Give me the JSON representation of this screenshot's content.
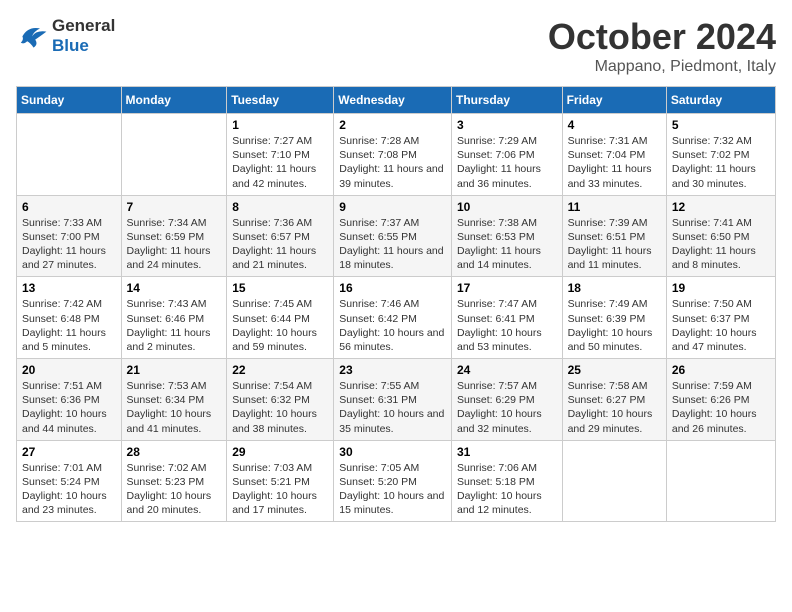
{
  "header": {
    "logo_line1": "General",
    "logo_line2": "Blue",
    "month_title": "October 2024",
    "location": "Mappano, Piedmont, Italy"
  },
  "days_of_week": [
    "Sunday",
    "Monday",
    "Tuesday",
    "Wednesday",
    "Thursday",
    "Friday",
    "Saturday"
  ],
  "weeks": [
    [
      {
        "num": "",
        "sunrise": "",
        "sunset": "",
        "daylight": ""
      },
      {
        "num": "",
        "sunrise": "",
        "sunset": "",
        "daylight": ""
      },
      {
        "num": "1",
        "sunrise": "Sunrise: 7:27 AM",
        "sunset": "Sunset: 7:10 PM",
        "daylight": "Daylight: 11 hours and 42 minutes."
      },
      {
        "num": "2",
        "sunrise": "Sunrise: 7:28 AM",
        "sunset": "Sunset: 7:08 PM",
        "daylight": "Daylight: 11 hours and 39 minutes."
      },
      {
        "num": "3",
        "sunrise": "Sunrise: 7:29 AM",
        "sunset": "Sunset: 7:06 PM",
        "daylight": "Daylight: 11 hours and 36 minutes."
      },
      {
        "num": "4",
        "sunrise": "Sunrise: 7:31 AM",
        "sunset": "Sunset: 7:04 PM",
        "daylight": "Daylight: 11 hours and 33 minutes."
      },
      {
        "num": "5",
        "sunrise": "Sunrise: 7:32 AM",
        "sunset": "Sunset: 7:02 PM",
        "daylight": "Daylight: 11 hours and 30 minutes."
      }
    ],
    [
      {
        "num": "6",
        "sunrise": "Sunrise: 7:33 AM",
        "sunset": "Sunset: 7:00 PM",
        "daylight": "Daylight: 11 hours and 27 minutes."
      },
      {
        "num": "7",
        "sunrise": "Sunrise: 7:34 AM",
        "sunset": "Sunset: 6:59 PM",
        "daylight": "Daylight: 11 hours and 24 minutes."
      },
      {
        "num": "8",
        "sunrise": "Sunrise: 7:36 AM",
        "sunset": "Sunset: 6:57 PM",
        "daylight": "Daylight: 11 hours and 21 minutes."
      },
      {
        "num": "9",
        "sunrise": "Sunrise: 7:37 AM",
        "sunset": "Sunset: 6:55 PM",
        "daylight": "Daylight: 11 hours and 18 minutes."
      },
      {
        "num": "10",
        "sunrise": "Sunrise: 7:38 AM",
        "sunset": "Sunset: 6:53 PM",
        "daylight": "Daylight: 11 hours and 14 minutes."
      },
      {
        "num": "11",
        "sunrise": "Sunrise: 7:39 AM",
        "sunset": "Sunset: 6:51 PM",
        "daylight": "Daylight: 11 hours and 11 minutes."
      },
      {
        "num": "12",
        "sunrise": "Sunrise: 7:41 AM",
        "sunset": "Sunset: 6:50 PM",
        "daylight": "Daylight: 11 hours and 8 minutes."
      }
    ],
    [
      {
        "num": "13",
        "sunrise": "Sunrise: 7:42 AM",
        "sunset": "Sunset: 6:48 PM",
        "daylight": "Daylight: 11 hours and 5 minutes."
      },
      {
        "num": "14",
        "sunrise": "Sunrise: 7:43 AM",
        "sunset": "Sunset: 6:46 PM",
        "daylight": "Daylight: 11 hours and 2 minutes."
      },
      {
        "num": "15",
        "sunrise": "Sunrise: 7:45 AM",
        "sunset": "Sunset: 6:44 PM",
        "daylight": "Daylight: 10 hours and 59 minutes."
      },
      {
        "num": "16",
        "sunrise": "Sunrise: 7:46 AM",
        "sunset": "Sunset: 6:42 PM",
        "daylight": "Daylight: 10 hours and 56 minutes."
      },
      {
        "num": "17",
        "sunrise": "Sunrise: 7:47 AM",
        "sunset": "Sunset: 6:41 PM",
        "daylight": "Daylight: 10 hours and 53 minutes."
      },
      {
        "num": "18",
        "sunrise": "Sunrise: 7:49 AM",
        "sunset": "Sunset: 6:39 PM",
        "daylight": "Daylight: 10 hours and 50 minutes."
      },
      {
        "num": "19",
        "sunrise": "Sunrise: 7:50 AM",
        "sunset": "Sunset: 6:37 PM",
        "daylight": "Daylight: 10 hours and 47 minutes."
      }
    ],
    [
      {
        "num": "20",
        "sunrise": "Sunrise: 7:51 AM",
        "sunset": "Sunset: 6:36 PM",
        "daylight": "Daylight: 10 hours and 44 minutes."
      },
      {
        "num": "21",
        "sunrise": "Sunrise: 7:53 AM",
        "sunset": "Sunset: 6:34 PM",
        "daylight": "Daylight: 10 hours and 41 minutes."
      },
      {
        "num": "22",
        "sunrise": "Sunrise: 7:54 AM",
        "sunset": "Sunset: 6:32 PM",
        "daylight": "Daylight: 10 hours and 38 minutes."
      },
      {
        "num": "23",
        "sunrise": "Sunrise: 7:55 AM",
        "sunset": "Sunset: 6:31 PM",
        "daylight": "Daylight: 10 hours and 35 minutes."
      },
      {
        "num": "24",
        "sunrise": "Sunrise: 7:57 AM",
        "sunset": "Sunset: 6:29 PM",
        "daylight": "Daylight: 10 hours and 32 minutes."
      },
      {
        "num": "25",
        "sunrise": "Sunrise: 7:58 AM",
        "sunset": "Sunset: 6:27 PM",
        "daylight": "Daylight: 10 hours and 29 minutes."
      },
      {
        "num": "26",
        "sunrise": "Sunrise: 7:59 AM",
        "sunset": "Sunset: 6:26 PM",
        "daylight": "Daylight: 10 hours and 26 minutes."
      }
    ],
    [
      {
        "num": "27",
        "sunrise": "Sunrise: 7:01 AM",
        "sunset": "Sunset: 5:24 PM",
        "daylight": "Daylight: 10 hours and 23 minutes."
      },
      {
        "num": "28",
        "sunrise": "Sunrise: 7:02 AM",
        "sunset": "Sunset: 5:23 PM",
        "daylight": "Daylight: 10 hours and 20 minutes."
      },
      {
        "num": "29",
        "sunrise": "Sunrise: 7:03 AM",
        "sunset": "Sunset: 5:21 PM",
        "daylight": "Daylight: 10 hours and 17 minutes."
      },
      {
        "num": "30",
        "sunrise": "Sunrise: 7:05 AM",
        "sunset": "Sunset: 5:20 PM",
        "daylight": "Daylight: 10 hours and 15 minutes."
      },
      {
        "num": "31",
        "sunrise": "Sunrise: 7:06 AM",
        "sunset": "Sunset: 5:18 PM",
        "daylight": "Daylight: 10 hours and 12 minutes."
      },
      {
        "num": "",
        "sunrise": "",
        "sunset": "",
        "daylight": ""
      },
      {
        "num": "",
        "sunrise": "",
        "sunset": "",
        "daylight": ""
      }
    ]
  ]
}
